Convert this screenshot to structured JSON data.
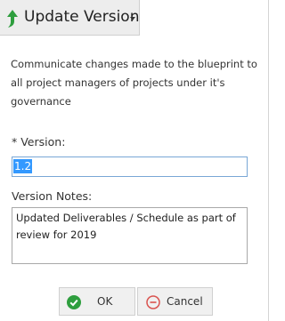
{
  "header": {
    "title": "Update Version"
  },
  "description": "Communicate changes made to the blueprint to all project managers of projects under it's governance",
  "version": {
    "label": "* Version:",
    "value": "1.2"
  },
  "notes": {
    "label": "Version Notes:",
    "value": "Updated Deliverables / Schedule as part of review for 2019"
  },
  "actions": {
    "ok_label": "OK",
    "cancel_label": "Cancel"
  },
  "colors": {
    "accent_green": "#2e9e3e",
    "cancel_red": "#d9534f",
    "focus_border": "#79a7d6"
  }
}
